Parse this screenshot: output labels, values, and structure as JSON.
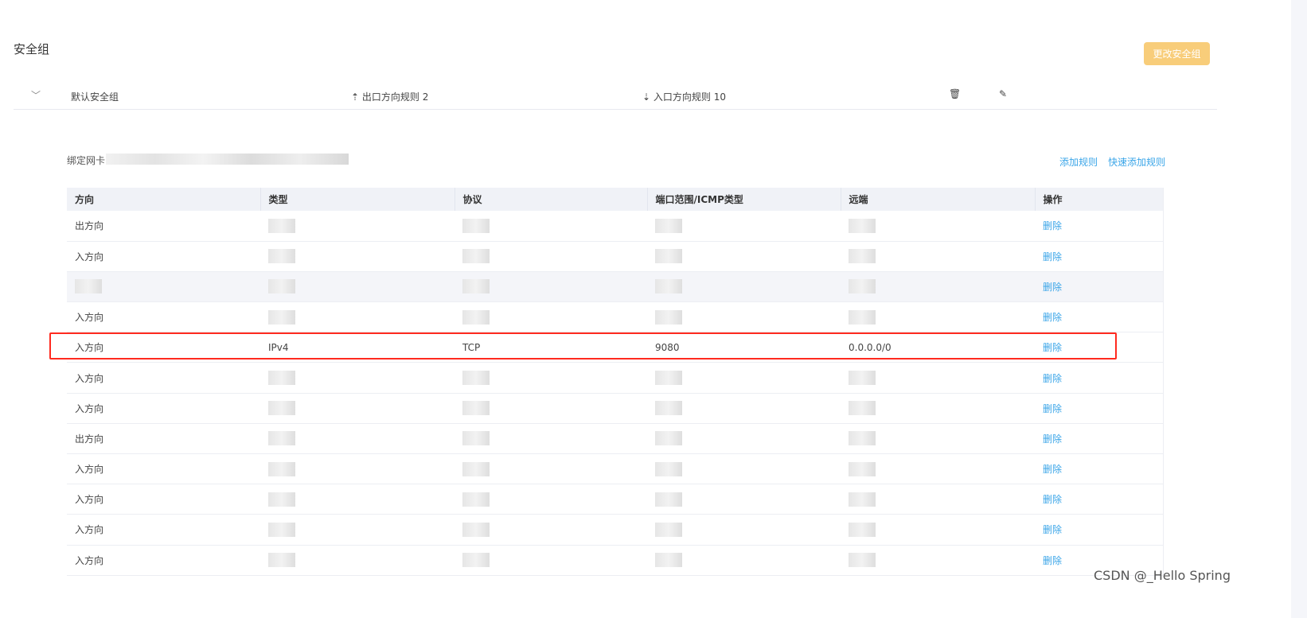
{
  "page": {
    "title": "安全组",
    "change_button": "更改安全组"
  },
  "group": {
    "name": "默认安全组",
    "outbound_label": "出口方向规则 2",
    "inbound_label": "入口方向规则 10",
    "chevron_icon": "chevron-down-icon",
    "outbound_icon": "upload-icon",
    "inbound_icon": "download-icon",
    "delete_icon": "trash-icon",
    "edit_icon": "pencil-icon"
  },
  "nic": {
    "label": "绑定网卡"
  },
  "actions": {
    "add_rule": "添加规则",
    "quick_add_rule": "快速添加规则"
  },
  "table": {
    "headers": [
      "方向",
      "类型",
      "协议",
      "端口范围/ICMP类型",
      "远端",
      "操作"
    ],
    "rows": [
      {
        "direction": "出方向",
        "type": "",
        "protocol": "",
        "port": "",
        "remote": "",
        "action": "删除"
      },
      {
        "direction": "入方向",
        "type": "",
        "protocol": "",
        "port": "",
        "remote": "",
        "action": "删除"
      },
      {
        "direction": "",
        "type": "",
        "protocol": "",
        "port": "",
        "remote": "",
        "action": "删除",
        "hover": true
      },
      {
        "direction": "入方向",
        "type": "",
        "protocol": "",
        "port": "",
        "remote": "",
        "action": "删除"
      },
      {
        "direction": "入方向",
        "type": "IPv4",
        "protocol": "TCP",
        "port": "9080",
        "remote": "0.0.0.0/0",
        "action": "删除",
        "highlighted": true
      },
      {
        "direction": "入方向",
        "type": "",
        "protocol": "",
        "port": "",
        "remote": "",
        "action": "删除"
      },
      {
        "direction": "入方向",
        "type": "",
        "protocol": "",
        "port": "",
        "remote": "",
        "action": "删除"
      },
      {
        "direction": "出方向",
        "type": "",
        "protocol": "",
        "port": "",
        "remote": "",
        "action": "删除"
      },
      {
        "direction": "入方向",
        "type": "",
        "protocol": "",
        "port": "",
        "remote": "",
        "action": "删除"
      },
      {
        "direction": "入方向",
        "type": "",
        "protocol": "",
        "port": "",
        "remote": "",
        "action": "删除"
      },
      {
        "direction": "入方向",
        "type": "",
        "protocol": "",
        "port": "",
        "remote": "",
        "action": "删除"
      },
      {
        "direction": "入方向",
        "type": "",
        "protocol": "",
        "port": "",
        "remote": "",
        "action": "删除"
      }
    ]
  },
  "colors": {
    "accent_link": "#3aa5e8",
    "button": "#f8cd7a",
    "highlight_border": "#ff2a1f"
  },
  "watermark": "CSDN @_Hello Spring"
}
